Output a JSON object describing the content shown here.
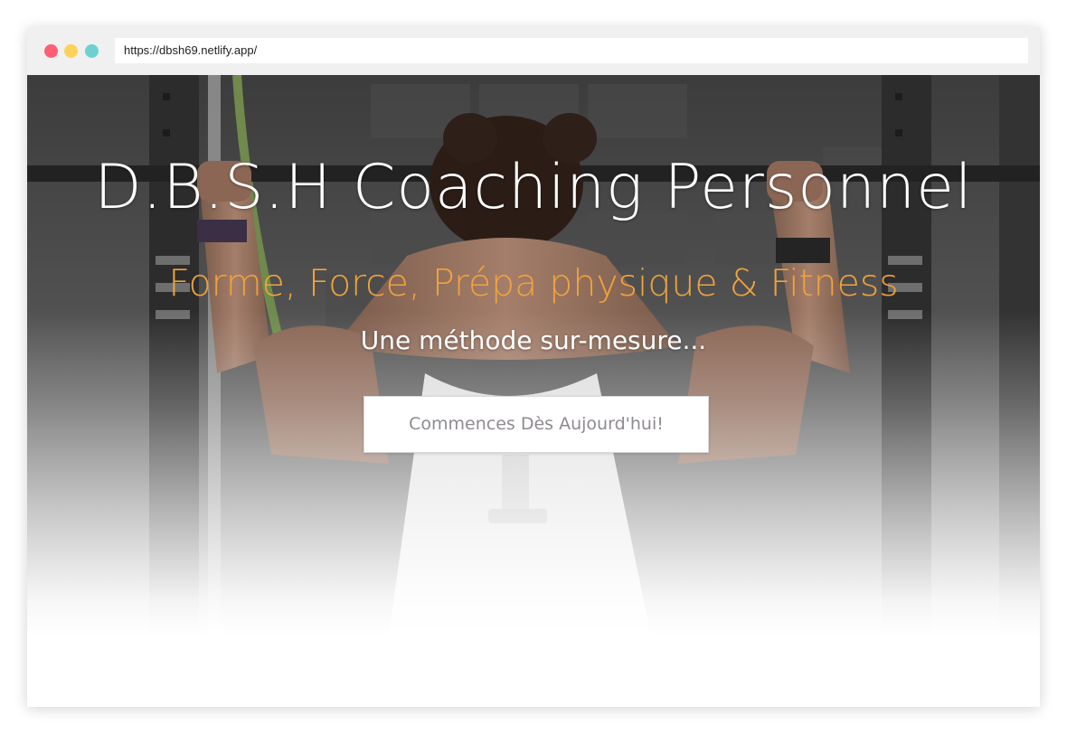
{
  "browser": {
    "url": "https://dbsh69.netlify.app/"
  },
  "hero": {
    "title": "D.B.S.H Coaching Personnel",
    "subtitle": "Forme, Force, Prépa physique & Fitness",
    "tagline": "Une méthode sur-mesure...",
    "cta_label": "Commences Dès Aujourd'hui!",
    "background_image": "athlete-gym-pullup-photo"
  },
  "colors": {
    "subtitle": "#f0a33c",
    "title": "#ffffff",
    "cta_text": "#8f8a91",
    "dot_red": "#fe5f74",
    "dot_yellow": "#fcd25a",
    "dot_teal": "#6fd0d2"
  }
}
